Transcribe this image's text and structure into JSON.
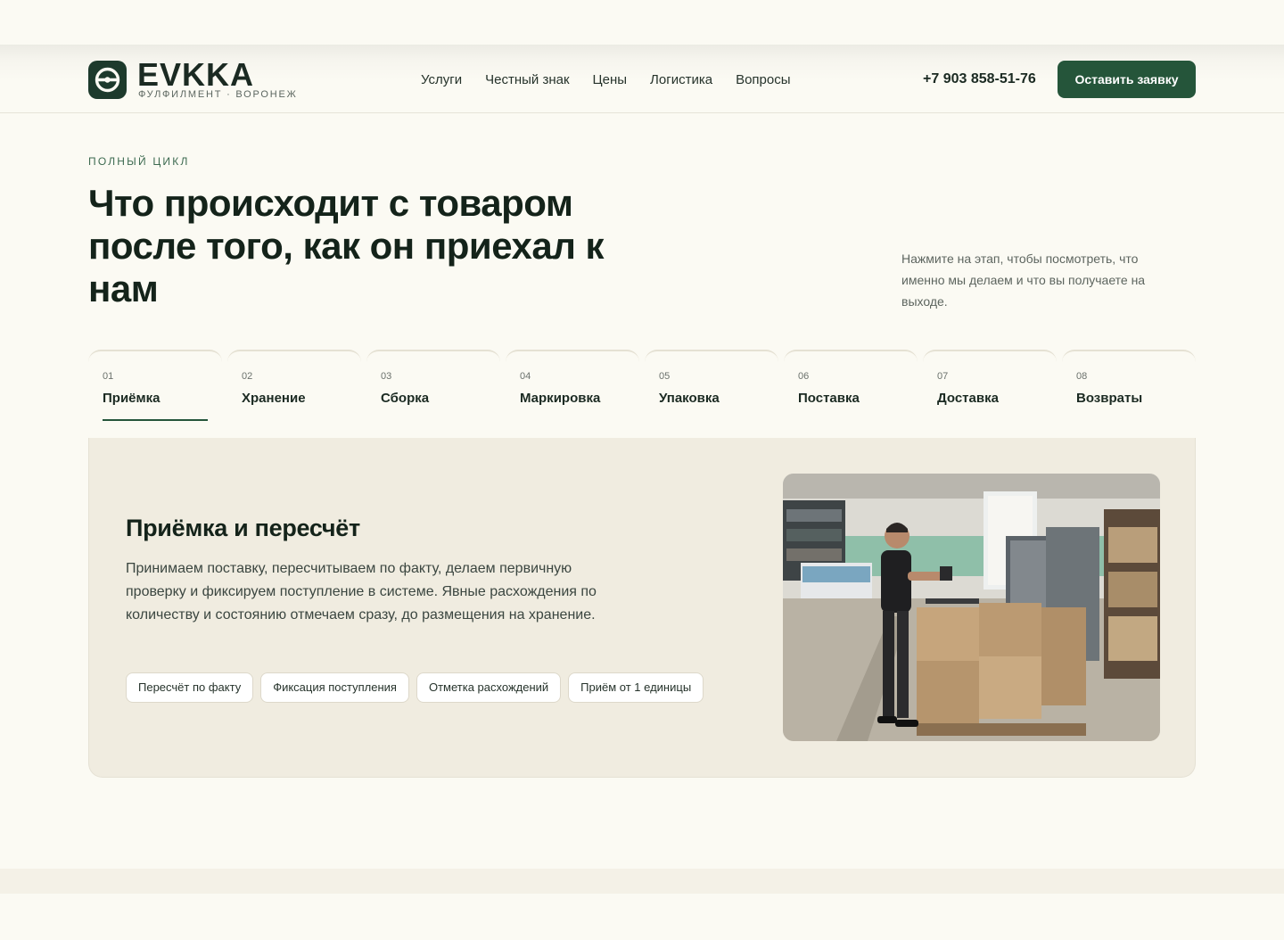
{
  "header": {
    "logo_word": "EVKKA",
    "logo_sub": "ФУЛФИЛМЕНТ · ВОРОНЕЖ",
    "nav": [
      "Услуги",
      "Честный знак",
      "Цены",
      "Логистика",
      "Вопросы"
    ],
    "phone": "+7 903 858-51-76",
    "cta": "Оставить заявку"
  },
  "hero": {
    "eyebrow": "ПОЛНЫЙ ЦИКЛ",
    "title": "Что происходит с товаром после того, как он приехал к нам",
    "hint": "Нажмите на этап, чтобы посмотреть, что именно мы делаем и что вы получаете на выходе."
  },
  "tabs": [
    {
      "num": "01",
      "label": "Приёмка",
      "active": true
    },
    {
      "num": "02",
      "label": "Хранение",
      "active": false
    },
    {
      "num": "03",
      "label": "Сборка",
      "active": false
    },
    {
      "num": "04",
      "label": "Маркировка",
      "active": false
    },
    {
      "num": "05",
      "label": "Упаковка",
      "active": false
    },
    {
      "num": "06",
      "label": "Поставка",
      "active": false
    },
    {
      "num": "07",
      "label": "Доставка",
      "active": false
    },
    {
      "num": "08",
      "label": "Возвраты",
      "active": false
    }
  ],
  "panel": {
    "title": "Приёмка и пересчёт",
    "text": "Принимаем поставку, пересчитываем по факту, делаем первичную проверку и фиксируем поступление в системе. Явные расхождения по количеству и состоянию отмечаем сразу, до размещения на хранение.",
    "chips": [
      "Пересчёт по факту",
      "Фиксация поступления",
      "Отметка расхождений",
      "Приём от 1 единицы"
    ]
  },
  "colors": {
    "accent": "#25553a",
    "background": "#fbfaf3",
    "panel": "#f0ece0",
    "text": "#1b2a22"
  },
  "icons": {
    "logo": "logo-icon",
    "photo": "warehouse-photo"
  }
}
